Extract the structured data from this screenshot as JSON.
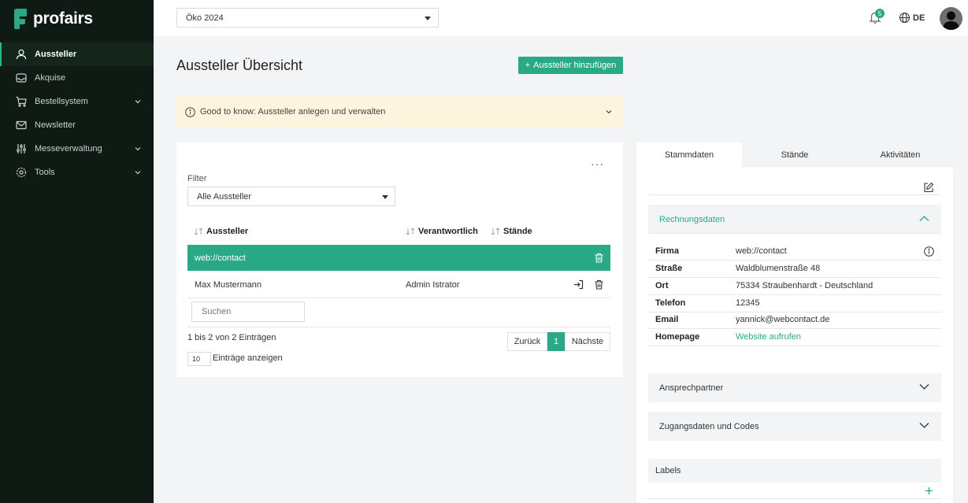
{
  "brand": {
    "name": "profairs",
    "accent": "#2aa987",
    "sidebar_bg": "#0f1a14"
  },
  "sidebar": {
    "items": [
      {
        "label": "Aussteller",
        "icon": "user-icon",
        "active": true
      },
      {
        "label": "Akquise",
        "icon": "inbox-icon"
      },
      {
        "label": "Bestellsystem",
        "icon": "cart-icon",
        "expandable": true
      },
      {
        "label": "Newsletter",
        "icon": "mail-icon"
      },
      {
        "label": "Messeverwaltung",
        "icon": "grid-icon",
        "expandable": true
      },
      {
        "label": "Tools",
        "icon": "gear-icon",
        "expandable": true
      }
    ]
  },
  "topbar": {
    "event_select": "Öko 2024",
    "notifications_count": "5",
    "language": "DE"
  },
  "main": {
    "title": "Aussteller Übersicht",
    "add_button": "Aussteller hinzufügen",
    "info": "Good to know: Aussteller anlegen und verwalten"
  },
  "list": {
    "filter_label": "Filter",
    "filter_value": "Alle Aussteller",
    "columns": [
      "Aussteller",
      "Verantwortlich",
      "Stände"
    ],
    "rows": [
      {
        "aussteller": "web://contact",
        "verantwortlich": "",
        "selected": true
      },
      {
        "aussteller": "Max Mustermann",
        "verantwortlich": "Admin Istrator",
        "selected": false
      }
    ],
    "search_placeholder": "Suchen",
    "info": "1 bis 2 von 2 Einträgen",
    "pagination": {
      "prev": "Zurück",
      "current": "1",
      "next": "Nächste"
    },
    "per_page": "10",
    "per_page_label": "Einträge anzeigen"
  },
  "detail": {
    "tabs": [
      "Stammdaten",
      "Stände",
      "Aktivitäten"
    ],
    "active_tab": "Stammdaten",
    "sections": {
      "rechnungsdaten": "Rechnungsdaten",
      "ansprechpartner": "Ansprechpartner",
      "zugangsdaten": "Zugangsdaten und Codes",
      "labels": "Labels"
    },
    "fields": [
      {
        "key": "Firma",
        "value": "web://contact"
      },
      {
        "key": "Straße",
        "value": "Waldblumenstraße 48"
      },
      {
        "key": "Ort",
        "value": "75334 Straubenhardt - Deutschland"
      },
      {
        "key": "Telefon",
        "value": "12345"
      },
      {
        "key": "Email",
        "value": "yannick@webcontact.de"
      },
      {
        "key": "Homepage",
        "value": "Website aufrufen"
      }
    ]
  }
}
